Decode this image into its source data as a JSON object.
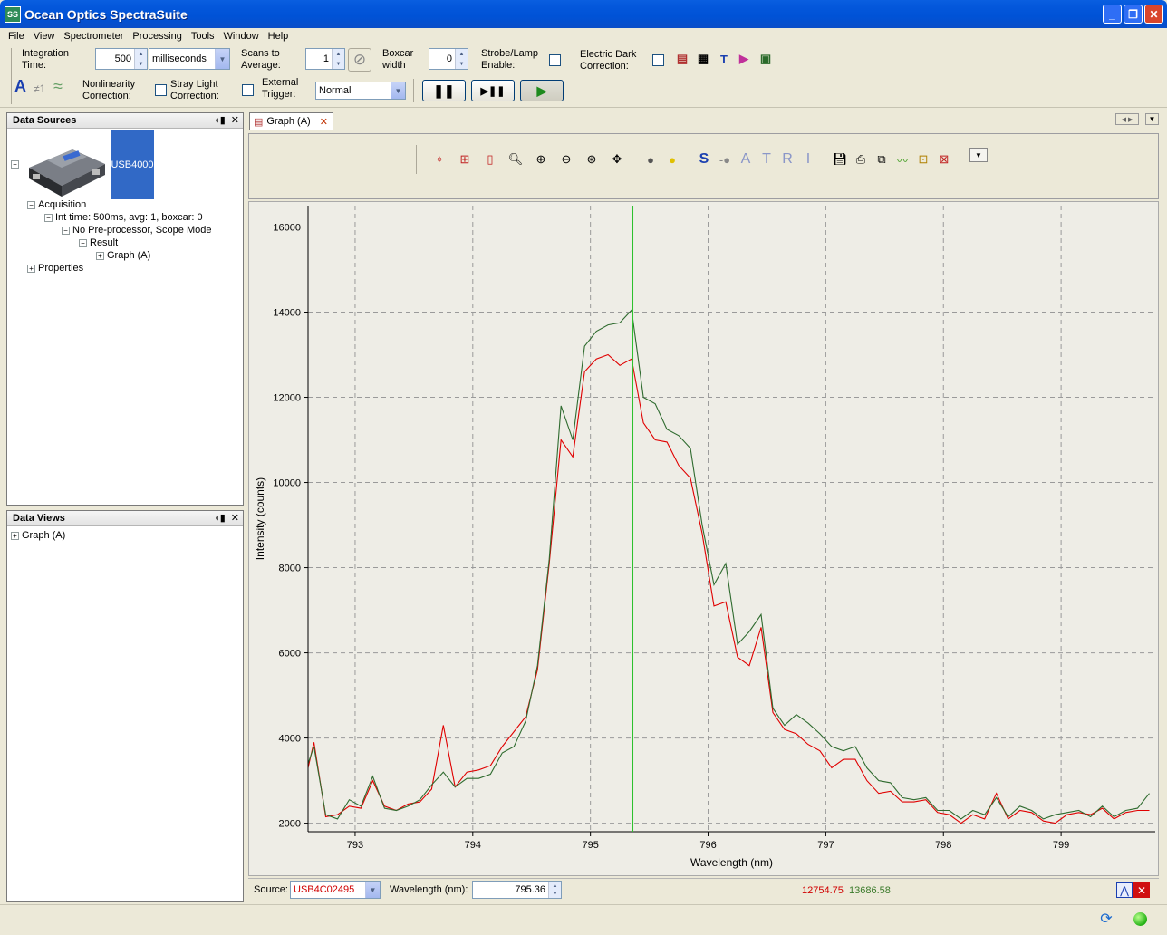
{
  "window": {
    "title": "Ocean Optics SpectraSuite",
    "app_icon": "SS"
  },
  "menu": [
    "File",
    "View",
    "Spectrometer",
    "Processing",
    "Tools",
    "Window",
    "Help"
  ],
  "toolbar": {
    "integration_label": "Integration Time:",
    "integration_value": "500",
    "integration_unit": "milliseconds",
    "scans_label": "Scans to Average:",
    "scans_value": "1",
    "boxcar_label": "Boxcar width",
    "boxcar_value": "0",
    "strobe_label": "Strobe/Lamp Enable:",
    "electric_dark_label": "Electric Dark Correction:",
    "nonlinearity_label": "Nonlinearity Correction:",
    "stray_light_label": "Stray Light Correction:",
    "external_trigger_label": "External Trigger:",
    "trigger_mode": "Normal",
    "symbol_a": "A",
    "symbol_ne1": "≠1"
  },
  "data_sources": {
    "title": "Data Sources",
    "device": "USB4000",
    "tree": [
      "Acquisition",
      "Int time: 500ms, avg: 1, boxcar: 0",
      "No Pre-processor, Scope Mode",
      "Result",
      "Graph (A)",
      "Properties"
    ]
  },
  "data_views": {
    "title": "Data Views",
    "items": [
      "Graph (A)"
    ]
  },
  "graph_tab": {
    "label": "Graph (A)"
  },
  "graph_toolbar_letters": [
    "S",
    "A",
    "T",
    "R",
    "I"
  ],
  "chart_data": {
    "type": "line",
    "title": "",
    "xlabel": "Wavelength (nm)",
    "ylabel": "Intensity (counts)",
    "xlim": [
      792.6,
      799.8
    ],
    "ylim": [
      1800,
      16500
    ],
    "xticks": [
      793,
      794,
      795,
      796,
      797,
      798,
      799
    ],
    "yticks": [
      2000,
      4000,
      6000,
      8000,
      10000,
      12000,
      14000,
      16000
    ],
    "grid": true,
    "cursor_x": 795.36,
    "series": [
      {
        "color": "#e00000",
        "x": [
          792.6,
          792.65,
          792.75,
          792.85,
          792.95,
          793.05,
          793.15,
          793.25,
          793.35,
          793.45,
          793.55,
          793.65,
          793.75,
          793.85,
          793.95,
          794.05,
          794.15,
          794.25,
          794.35,
          794.45,
          794.55,
          794.65,
          794.75,
          794.85,
          794.95,
          795.05,
          795.15,
          795.25,
          795.35,
          795.45,
          795.55,
          795.65,
          795.75,
          795.85,
          795.95,
          796.05,
          796.15,
          796.25,
          796.35,
          796.45,
          796.55,
          796.65,
          796.75,
          796.85,
          796.95,
          797.05,
          797.15,
          797.25,
          797.35,
          797.45,
          797.55,
          797.65,
          797.75,
          797.85,
          797.95,
          798.05,
          798.15,
          798.25,
          798.35,
          798.45,
          798.55,
          798.65,
          798.75,
          798.85,
          798.95,
          799.05,
          799.15,
          799.25,
          799.35,
          799.45,
          799.55,
          799.65,
          799.75
        ],
        "y": [
          3300,
          3900,
          2150,
          2200,
          2400,
          2350,
          3000,
          2400,
          2300,
          2450,
          2500,
          2800,
          4300,
          2850,
          3200,
          3250,
          3350,
          3800,
          4150,
          4500,
          5600,
          8100,
          11000,
          10600,
          12600,
          12900,
          13000,
          12750,
          12900,
          11400,
          11000,
          10950,
          10400,
          10100,
          8800,
          7100,
          7200,
          5900,
          5700,
          6600,
          4600,
          4200,
          4100,
          3850,
          3700,
          3300,
          3500,
          3500,
          3000,
          2700,
          2750,
          2500,
          2500,
          2550,
          2250,
          2200,
          2000,
          2200,
          2100,
          2700,
          2100,
          2300,
          2250,
          2050,
          2000,
          2200,
          2250,
          2200,
          2350,
          2100,
          2250,
          2300,
          2300
        ]
      },
      {
        "color": "#2f6b2f",
        "x": [
          792.6,
          792.65,
          792.75,
          792.85,
          792.95,
          793.05,
          793.15,
          793.25,
          793.35,
          793.45,
          793.55,
          793.65,
          793.75,
          793.85,
          793.95,
          794.05,
          794.15,
          794.25,
          794.35,
          794.45,
          794.55,
          794.65,
          794.75,
          794.85,
          794.95,
          795.05,
          795.15,
          795.25,
          795.35,
          795.45,
          795.55,
          795.65,
          795.75,
          795.85,
          795.95,
          796.05,
          796.15,
          796.25,
          796.35,
          796.45,
          796.55,
          796.65,
          796.75,
          796.85,
          796.95,
          797.05,
          797.15,
          797.25,
          797.35,
          797.45,
          797.55,
          797.65,
          797.75,
          797.85,
          797.95,
          798.05,
          798.15,
          798.25,
          798.35,
          798.45,
          798.55,
          798.65,
          798.75,
          798.85,
          798.95,
          799.05,
          799.15,
          799.25,
          799.35,
          799.45,
          799.55,
          799.65,
          799.75
        ],
        "y": [
          3400,
          3800,
          2200,
          2100,
          2550,
          2400,
          3100,
          2350,
          2300,
          2400,
          2550,
          2900,
          3200,
          2850,
          3050,
          3050,
          3150,
          3650,
          3800,
          4400,
          5700,
          8200,
          11800,
          11000,
          13200,
          13550,
          13700,
          13750,
          14050,
          12000,
          11850,
          11250,
          11100,
          10800,
          9000,
          7600,
          8100,
          6200,
          6500,
          6900,
          4700,
          4300,
          4550,
          4350,
          4100,
          3800,
          3700,
          3800,
          3300,
          3000,
          2950,
          2600,
          2550,
          2600,
          2300,
          2300,
          2100,
          2300,
          2200,
          2600,
          2150,
          2400,
          2300,
          2100,
          2200,
          2250,
          2300,
          2150,
          2400,
          2150,
          2300,
          2350,
          2700
        ]
      }
    ]
  },
  "status": {
    "source_label": "Source:",
    "source_value": "USB4C02495",
    "wavelength_label": "Wavelength (nm):",
    "wavelength_value": "795.36",
    "red_value": "12754.75",
    "green_value": "13686.58",
    "red_color": "#d00000",
    "green_color": "#3a7a2a"
  }
}
